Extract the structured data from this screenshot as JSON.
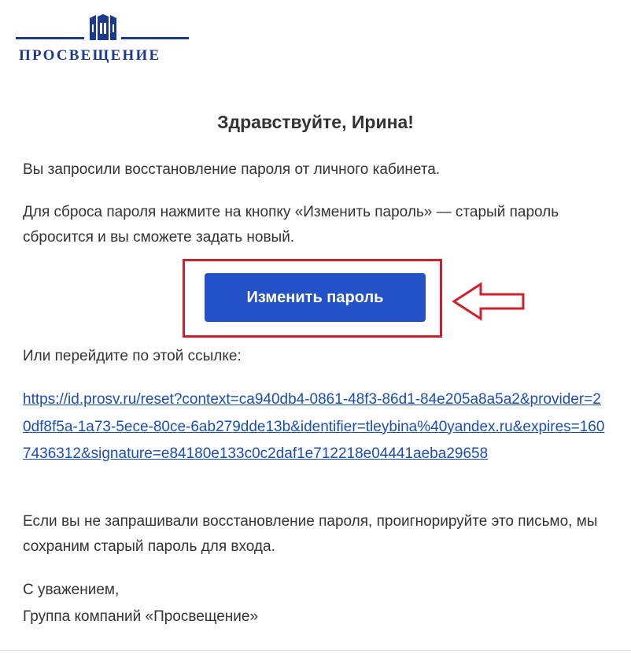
{
  "brand": {
    "name": "ПРОСВЕЩЕНИЕ"
  },
  "email": {
    "greeting": "Здравствуйте, Ирина!",
    "intro": "Вы запросили восстановление пароля от личного кабинета.",
    "instruction": "Для сброса пароля нажмите на кнопку «Изменить пароль» — старый пароль сбросится и вы сможете задать новый.",
    "button_label": "Изменить пароль",
    "alt_text": "Или перейдите по этой ссылке:",
    "reset_link": "https://id.prosv.ru/reset?context=ca940db4-0861-48f3-86d1-84e205a8a5a2&provider=20df8f5a-1a73-5ece-80ce-6ab279dde13b&identifier=tleybina%40yandex.ru&expires=1607436312&signature=e84180e133c0c2daf1e712218e04441aeba29658",
    "ignore_note": "Если вы не запрашивали восстановление пароля, проигнорируйте это письмо, мы сохраним старый пароль для входа.",
    "closing": "С уважением,",
    "signature": "Группа компаний «Просвещение»"
  },
  "colors": {
    "brand_blue": "#1b3a8c",
    "button_blue": "#2352c8",
    "link_blue": "#1a4db5",
    "annotation_red": "#d0202a"
  },
  "icons": {
    "emblem": "prosv-emblem-icon",
    "annotation_arrow": "left-arrow-icon"
  }
}
